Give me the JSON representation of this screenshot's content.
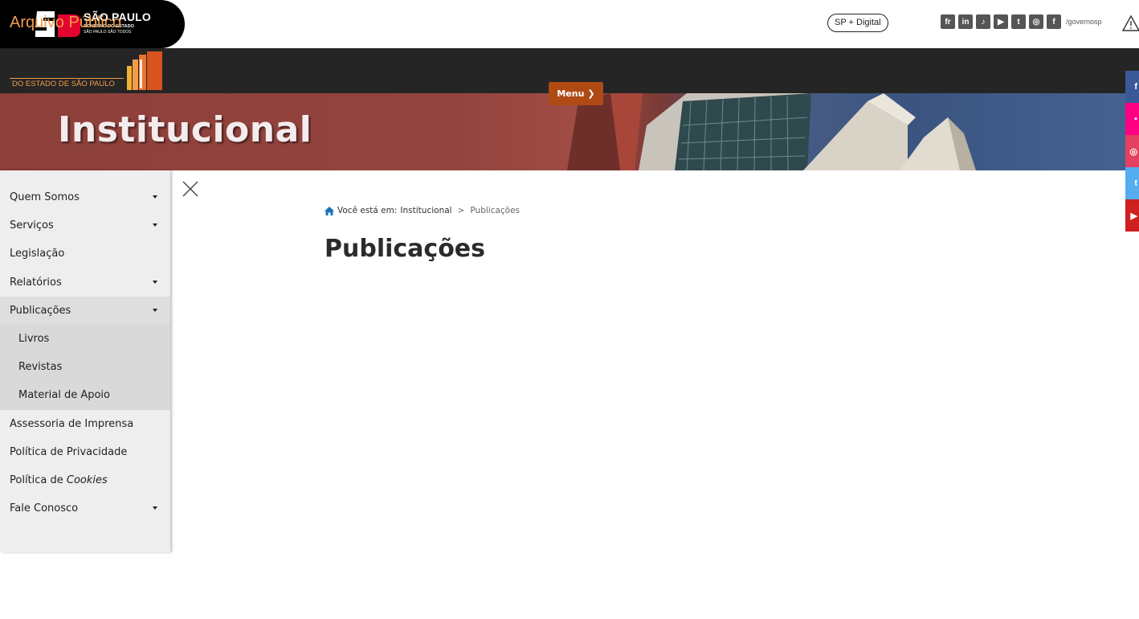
{
  "gov_header": {
    "logo_title": "SÃO PAULO",
    "logo_subtitle": "GOVERNO DO ESTADO",
    "logo_tagline": "SÃO PAULO SÃO TODOS",
    "sp_digital_label": "SP + Digital",
    "social_icons": [
      "flickr",
      "linkedin",
      "tiktok",
      "youtube",
      "twitter",
      "instagram",
      "facebook"
    ],
    "social_handle": "/governosp"
  },
  "brand": {
    "name": "Arquivo Público",
    "subname": "DO ESTADO DE SÃO PAULO"
  },
  "hero": {
    "title": "Institucional"
  },
  "menu_button": {
    "label": "Menu"
  },
  "side_social": [
    {
      "icon": "facebook",
      "color": "#3b5998"
    },
    {
      "icon": "flickr",
      "color": "#ff0084"
    },
    {
      "icon": "instagram",
      "color": "#e4405f"
    },
    {
      "icon": "twitter",
      "color": "#55acee"
    },
    {
      "icon": "youtube",
      "color": "#cd201f"
    }
  ],
  "sidebar": {
    "items": [
      {
        "label": "Quem Somos",
        "has_caret": true
      },
      {
        "label": "Serviços",
        "has_caret": true
      },
      {
        "label": "Legislação",
        "has_caret": false
      },
      {
        "label": "Relatórios",
        "has_caret": true
      },
      {
        "label": "Publicações",
        "has_caret": true,
        "active": true
      },
      {
        "label": "Livros",
        "sub": true
      },
      {
        "label": "Revistas",
        "sub": true
      },
      {
        "label": "Material de Apoio",
        "sub": true
      },
      {
        "label": "Assessoria de Imprensa",
        "has_caret": false
      },
      {
        "label": "Política de Privacidade",
        "has_caret": false
      },
      {
        "label": "Política de ",
        "label_italic": "Cookies",
        "has_caret": false
      },
      {
        "label": "Fale Conosco",
        "has_caret": true
      }
    ]
  },
  "breadcrumb": {
    "prefix": "Você está em:",
    "parent": "Institucional",
    "separator": ">",
    "current": "Publicações"
  },
  "main": {
    "title": "Publicações"
  }
}
